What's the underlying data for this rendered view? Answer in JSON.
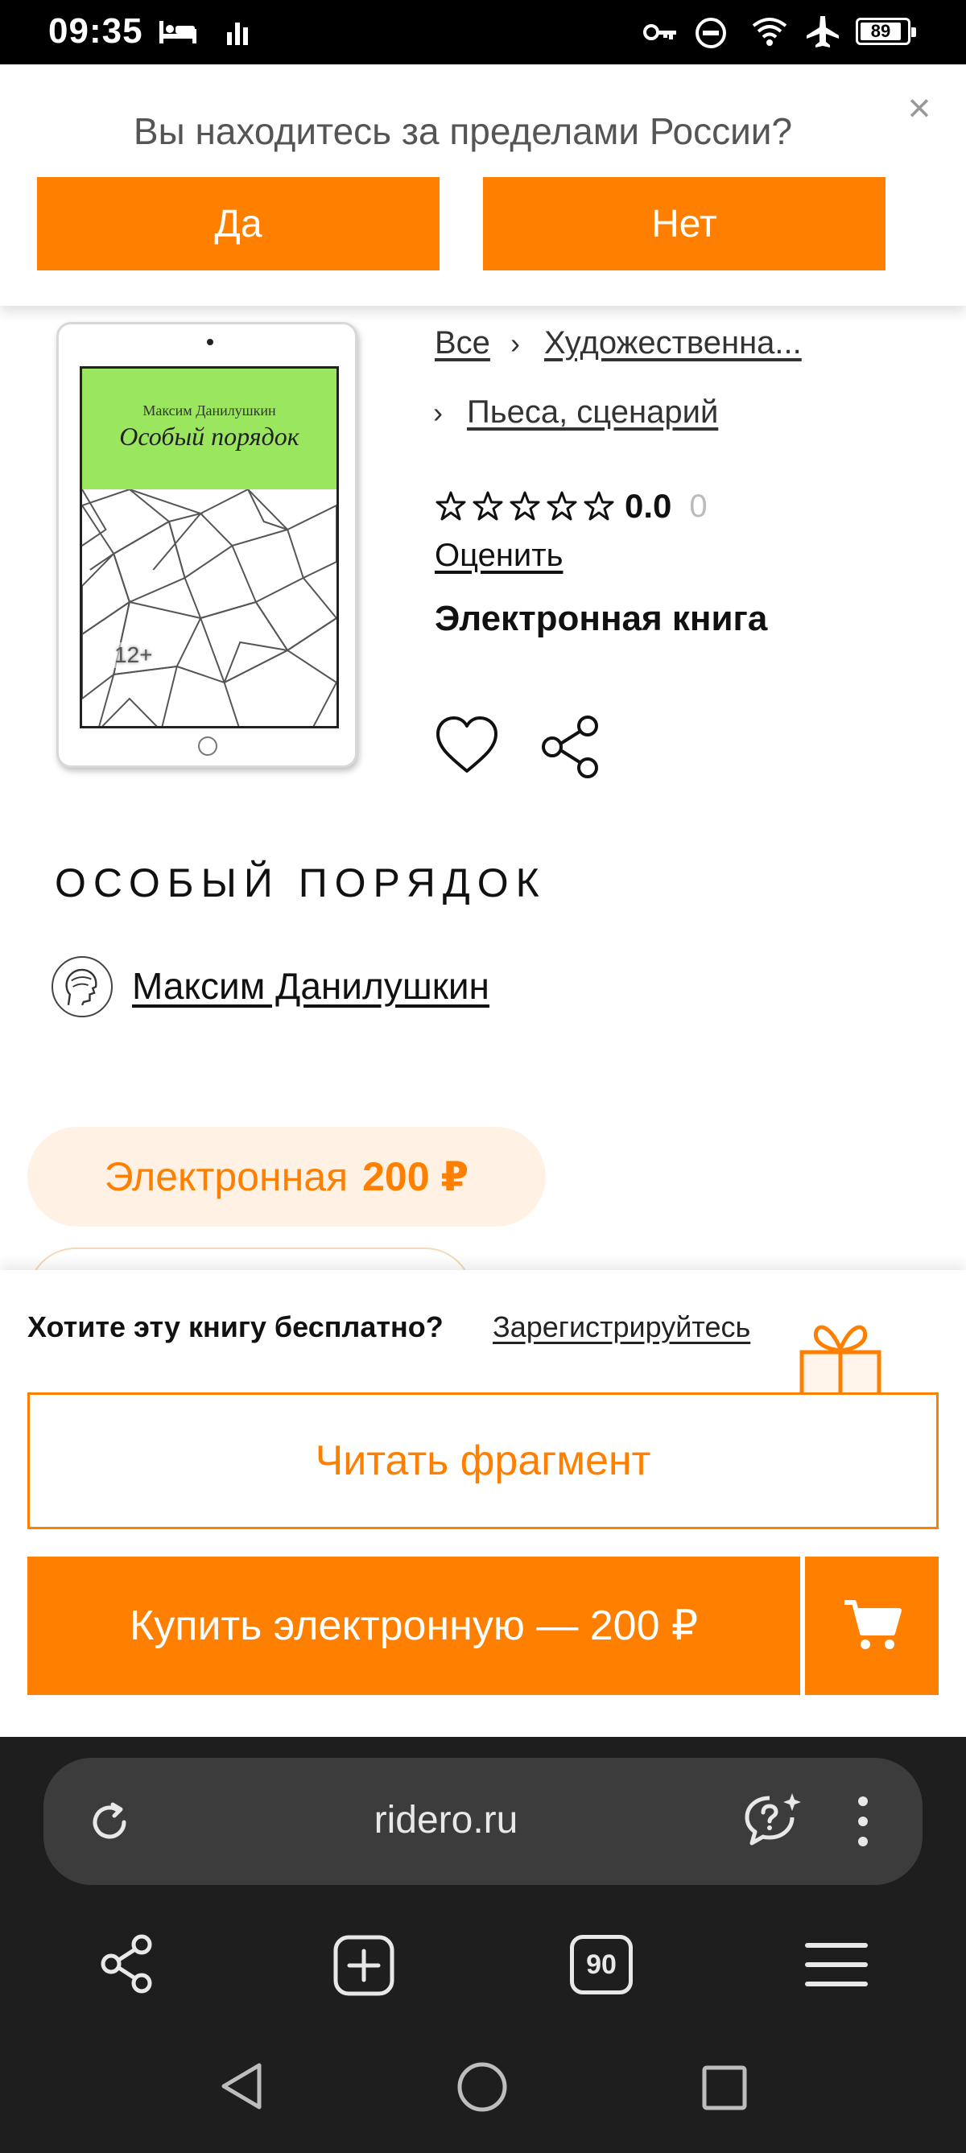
{
  "status_bar": {
    "time": "09:35",
    "battery": "89",
    "icons": [
      "sleep-icon",
      "signal-bars-icon",
      "vpn-key-icon",
      "do-not-disturb-icon",
      "wifi-icon",
      "airplane-icon",
      "battery-icon"
    ]
  },
  "region_banner": {
    "question": "Вы находитесь за пределами России?",
    "yes_label": "Да",
    "no_label": "Нет",
    "close_label": "×"
  },
  "cover": {
    "author": "Максим Данилушкин",
    "title": "Особый порядок",
    "age_rating": "12+",
    "accent_color": "#9ae65e"
  },
  "breadcrumbs": {
    "all": "Все",
    "separator": "›",
    "category": "Художественна...",
    "subcategory": "Пьеса, сценарий"
  },
  "rating": {
    "value": "0.0",
    "count": "0",
    "stars_filled": 0,
    "stars_total": 5,
    "rate_label": "Оценить"
  },
  "format_label": "Электронная книга",
  "book": {
    "title": "ОСОБЫЙ ПОРЯДОК",
    "author": "Максим Данилушкин"
  },
  "formats": {
    "ebook_label": "Электронная",
    "ebook_price": "200 ₽"
  },
  "buy_panel": {
    "free_question": "Хотите эту книгу бесплатно?",
    "register_label": "Зарегистрируйтесь",
    "read_fragment_label": "Читать фрагмент",
    "buy_label": "Купить электронную — 200 ₽"
  },
  "browser": {
    "url": "ridero.ru",
    "tabs_count": "90"
  },
  "colors": {
    "accent": "#ff8000",
    "accent_light": "#fff2e5",
    "browser_bg": "#1e1e1e",
    "urlbar_bg": "#3c3c3c"
  }
}
